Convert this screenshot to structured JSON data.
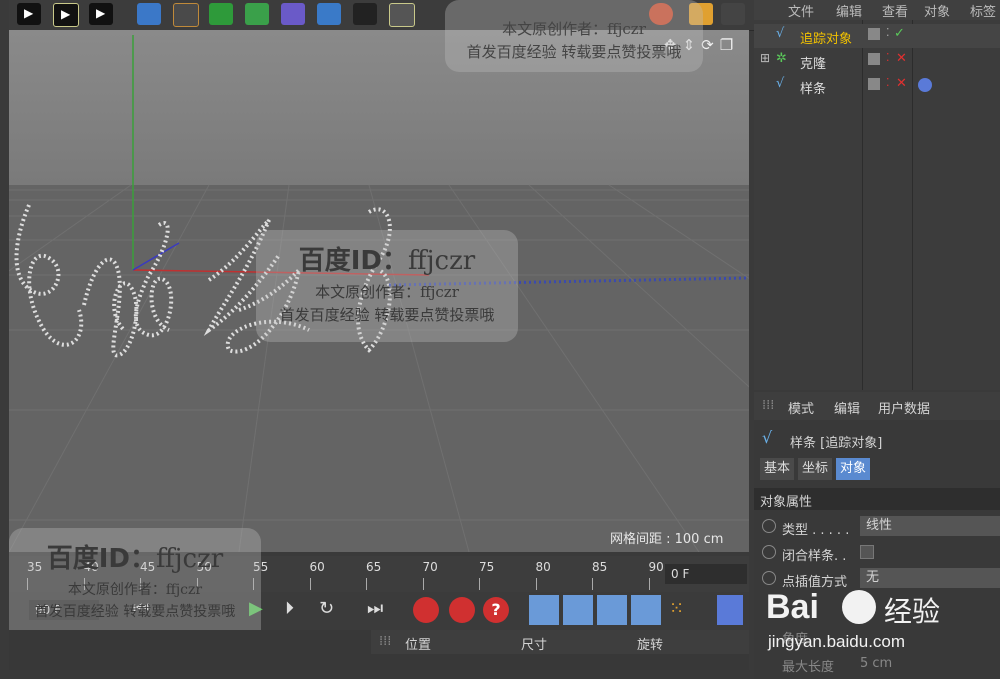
{
  "toolbar": {
    "icons": [
      "play-icon",
      "play-icon",
      "play-icon",
      "cube-icon",
      "spline-icon",
      "nurbs-icon",
      "array-icon",
      "deformer-icon",
      "scene-icon",
      "camera-icon",
      "light-icon"
    ]
  },
  "viewport": {
    "grid_spacing_label": "网格间距 : 100 cm"
  },
  "watermarks": {
    "baidu_id": "百度ID：",
    "author_id": "ffjczr",
    "line1": "本文原创作者：ffjczr",
    "line2": "首发百度经验 转载要点赞投票哦",
    "top_line1": "本文原创作者：ffjczr",
    "top_line2": "首发百度经验 转载要点赞投票哦",
    "logo_text": "Bai",
    "logo_suffix": "经验",
    "logo_url": "jingyan.baidu.com"
  },
  "object_manager": {
    "menu": [
      "文件",
      "编辑",
      "查看",
      "对象",
      "标签"
    ],
    "rows": [
      {
        "label": "追踪对象",
        "color": "#f2c200"
      },
      {
        "label": "克隆",
        "color": "#dddddd"
      },
      {
        "label": "样条",
        "color": "#dddddd"
      }
    ]
  },
  "attribute_manager": {
    "menu": [
      "模式",
      "编辑",
      "用户数据"
    ],
    "title": "样条 [追踪对象]",
    "tabs": [
      "基本",
      "坐标",
      "对象"
    ],
    "section": "对象属性",
    "fields": [
      {
        "label": "类型 . . . . .",
        "value": "线性"
      },
      {
        "label": "闭合样条. .",
        "value": ""
      },
      {
        "label": "点插值方式",
        "value": "无"
      },
      {
        "label": "角度",
        "value": ""
      },
      {
        "label": "最大长度",
        "value": "5 cm"
      }
    ]
  },
  "timeline": {
    "ticks": [
      "35",
      "40",
      "45",
      "50",
      "55",
      "60",
      "65",
      "70",
      "75",
      "80",
      "85",
      "90"
    ],
    "frame_field": "0 F"
  },
  "transport": {
    "frame_field": "90 F"
  },
  "coord_panel": {
    "headers": [
      "位置",
      "尺寸",
      "旋转"
    ]
  }
}
